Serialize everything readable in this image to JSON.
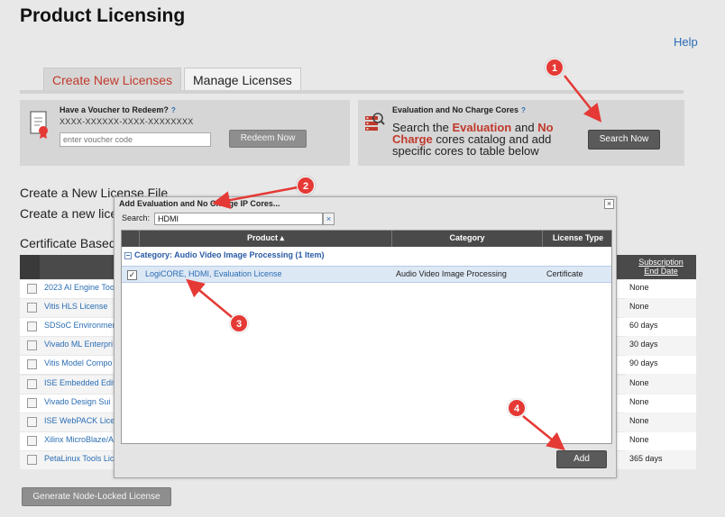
{
  "page": {
    "title": "Product Licensing",
    "help": "Help"
  },
  "tabs": [
    {
      "label": "Create New Licenses"
    },
    {
      "label": "Manage Licenses"
    }
  ],
  "voucher": {
    "title": "Have a Voucher to Redeem?",
    "help": "?",
    "mask": "XXXX-XXXXXX-XXXX-XXXXXXXX",
    "placeholder": "enter voucher code",
    "button": "Redeem Now"
  },
  "eval": {
    "title": "Evaluation and No Charge Cores",
    "help": "?",
    "desc_prefix": "Search the",
    "desc_evaluation": "Evaluation",
    "desc_and": "and",
    "desc_no": "No",
    "desc_charge": "Charge",
    "desc_suffix": "cores catalog and add specific cores to table below",
    "button": "Search Now"
  },
  "sections": {
    "create_file": "Create a New License File",
    "create_line": "Create a new lice",
    "cert_based": "Certificate Based"
  },
  "background_table": {
    "subscription_header": "Subscription End Date",
    "rows": [
      {
        "name": "2023 AI Engine Too",
        "sub": "None"
      },
      {
        "name": "Vitis HLS License",
        "sub": "None"
      },
      {
        "name": "SDSoC Environmen",
        "sub": "60 days"
      },
      {
        "name": "Vivado ML Enterpri",
        "sub": "30 days"
      },
      {
        "name": "Vitis Model Compo",
        "sub": "90 days"
      },
      {
        "name": "ISE Embedded Edit",
        "sub": "None"
      },
      {
        "name": "Vivado Design Sui",
        "sub": "None"
      },
      {
        "name": "ISE WebPACK Lice",
        "sub": "None"
      },
      {
        "name": "Xilinx MicroBlaze/A",
        "sub": "None"
      },
      {
        "name": "PetaLinux Tools Lic",
        "sub": "365 days"
      }
    ],
    "generate_button": "Generate Node-Locked License"
  },
  "modal": {
    "title": "Add Evaluation and No Charge IP Cores...",
    "close": "×",
    "search_label": "Search:",
    "search_value": "HDMI",
    "search_clear": "×",
    "columns": {
      "product": "Product ▴",
      "category": "Category",
      "license_type": "License Type"
    },
    "category_row": "Category: Audio Video Image Processing (1 Item)",
    "row": {
      "checked": "✓",
      "product": "LogiCORE, HDMI, Evaluation License",
      "category": "Audio Video Image Processing",
      "license_type": "Certificate"
    },
    "add_button": "Add"
  },
  "callouts": [
    "1",
    "2",
    "3",
    "4"
  ],
  "colors": {
    "accent_red": "#c0392b",
    "link_blue": "#2a6db3",
    "callout_red": "#e53935"
  }
}
